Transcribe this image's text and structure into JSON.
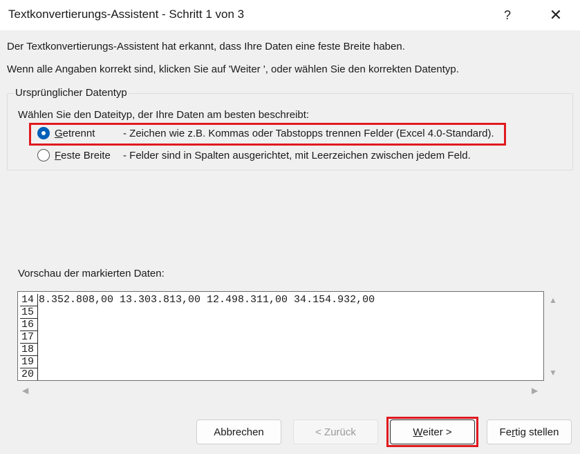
{
  "window": {
    "title": "Textkonvertierungs-Assistent - Schritt 1 von 3",
    "help_label": "?",
    "close_label": "✕"
  },
  "intro": {
    "line1": "Der Textkonvertierungs-Assistent hat erkannt, dass Ihre Daten eine feste Breite haben.",
    "line2": "Wenn alle Angaben korrekt sind, klicken Sie auf 'Weiter ', oder wählen Sie den korrekten Datentyp."
  },
  "datatype_group": {
    "legend": "Ursprünglicher Datentyp",
    "prompt": "Wählen Sie den Dateityp, der Ihre Daten am besten beschreibt:",
    "options": [
      {
        "label_mnemonic": "G",
        "label_rest": "etrennt",
        "description": "- Zeichen wie z.B. Kommas oder Tabstopps trennen Felder (Excel 4.0-Standard).",
        "selected": true
      },
      {
        "label_mnemonic": "F",
        "label_rest": "este Breite",
        "description": "- Felder sind in Spalten ausgerichtet, mit Leerzeichen zwischen jedem Feld.",
        "selected": false
      }
    ]
  },
  "preview": {
    "label": "Vorschau der markierten Daten:",
    "rows": [
      {
        "num": "14",
        "data": "8.352.808,00 13.303.813,00 12.498.311,00 34.154.932,00"
      },
      {
        "num": "15",
        "data": ""
      },
      {
        "num": "16",
        "data": ""
      },
      {
        "num": "17",
        "data": ""
      },
      {
        "num": "18",
        "data": ""
      },
      {
        "num": "19",
        "data": ""
      },
      {
        "num": "20",
        "data": ""
      }
    ],
    "scroll_up_icon": "▲",
    "scroll_down_icon": "▼",
    "scroll_left_icon": "◀",
    "scroll_right_icon": "▶"
  },
  "buttons": {
    "cancel": "Abbrechen",
    "back": "< Zurück",
    "next_mnemonic": "W",
    "next_rest": "eiter >",
    "finish_pre": "Fe",
    "finish_mnemonic": "r",
    "finish_rest": "tig stellen"
  },
  "colors": {
    "accent": "#005fb8",
    "highlight": "#e0191f"
  }
}
